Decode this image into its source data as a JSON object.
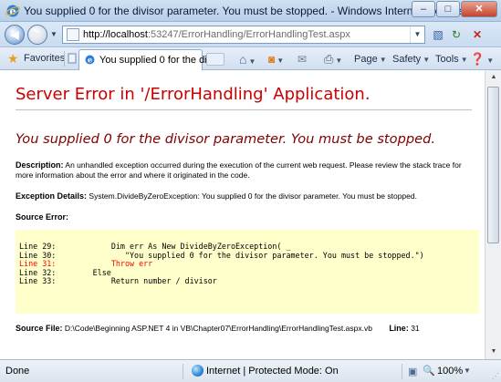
{
  "window": {
    "title": "You supplied 0 for the divisor parameter. You must be stopped. - Windows Internet Explorer",
    "minimize_glyph": "–",
    "maximize_glyph": "□",
    "close_glyph": "✕"
  },
  "nav": {
    "url_host": "http://localhost",
    "url_rest": ":53247/ErrorHandling/ErrorHandlingTest.aspx"
  },
  "tabs": {
    "favorites_label": "Favorites",
    "active_tab_label": "You supplied 0 for the divi..."
  },
  "commands": {
    "page_label": "Page",
    "safety_label": "Safety",
    "tools_label": "Tools"
  },
  "page": {
    "heading": "Server Error in '/ErrorHandling' Application.",
    "error_message": "You supplied 0 for the divisor parameter. You must be stopped.",
    "description_label": "Description:",
    "description_text": "An unhandled exception occurred during the execution of the current web request. Please review the stack trace for more information about the error and where it originated in the code.",
    "exception_label": "Exception Details:",
    "exception_text": "System.DivideByZeroException: You supplied 0 for the divisor parameter. You must be stopped.",
    "source_error_label": "Source Error:",
    "code_lines": [
      {
        "prefix": "Line 29:",
        "text": "            Dim err As New DivideByZeroException( _",
        "highlight": false
      },
      {
        "prefix": "Line 30:",
        "text": "               \"You supplied 0 for the divisor parameter. You must be stopped.\")",
        "highlight": false
      },
      {
        "prefix": "Line 31:",
        "text": "            Throw err",
        "highlight": true
      },
      {
        "prefix": "Line 32:",
        "text": "        Else",
        "highlight": false
      },
      {
        "prefix": "Line 33:",
        "text": "            Return number / divisor",
        "highlight": false
      }
    ],
    "source_file_label": "Source File:",
    "source_file_path": "D:\\Code\\Beginning ASP.NET 4 in VB\\Chapter07\\ErrorHandling\\ErrorHandlingTest.aspx.vb",
    "line_label": "Line:",
    "line_number": "31"
  },
  "status": {
    "text": "Done",
    "zone": "Internet | Protected Mode: On",
    "zoom": "100%"
  },
  "colors": {
    "heading": "#cc0000",
    "error_message": "#800000",
    "code_background": "#ffffcc",
    "highlight_line": "#ff0000"
  }
}
